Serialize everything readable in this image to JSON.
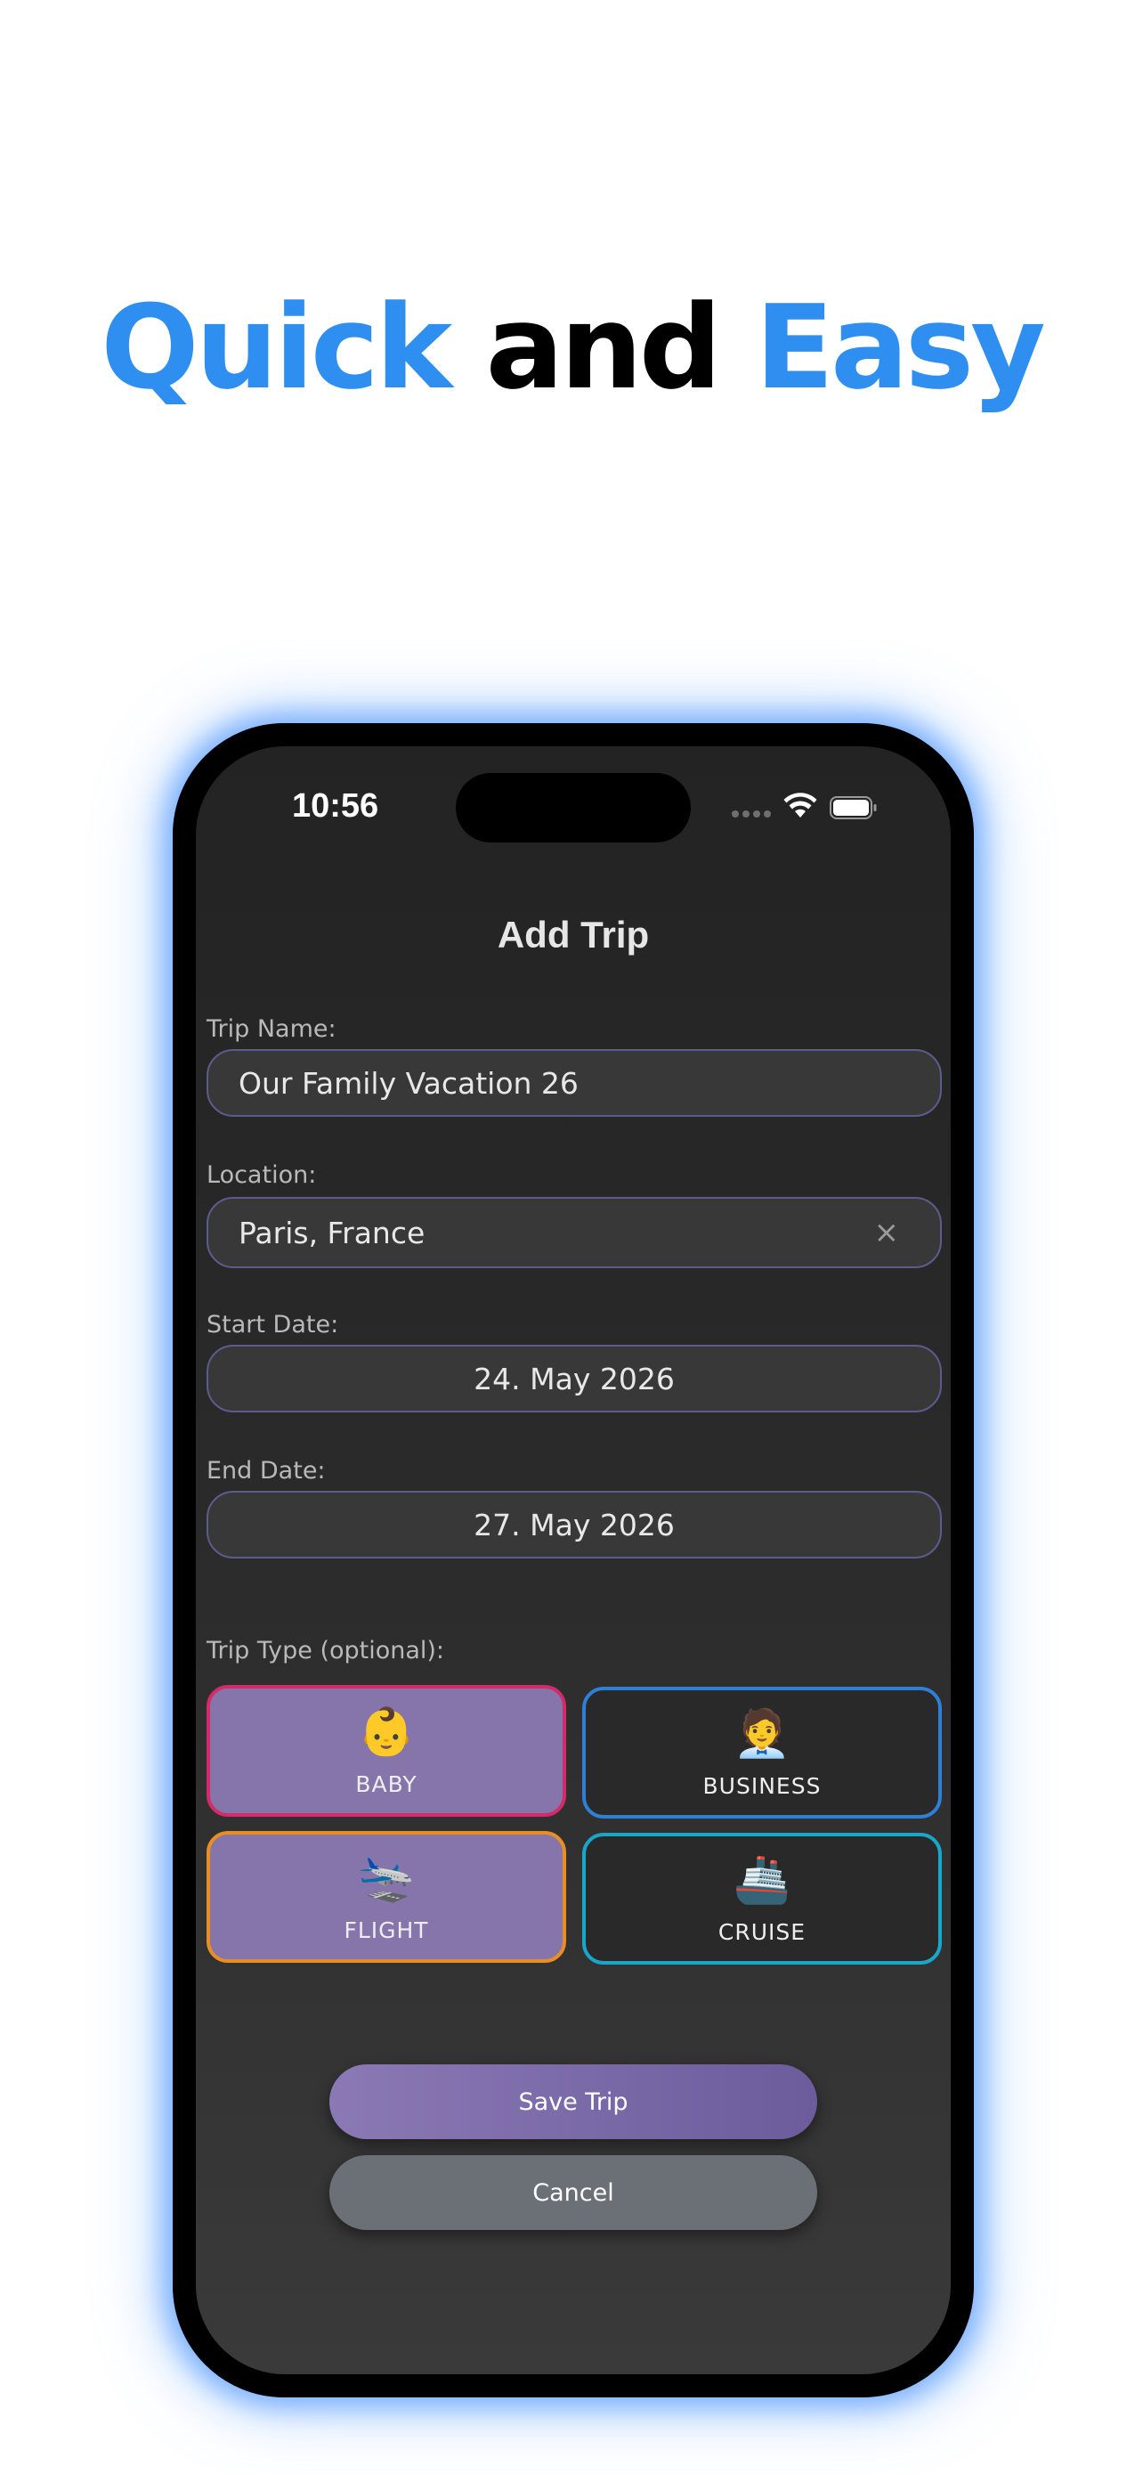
{
  "headline": {
    "word1": "Quick",
    "word2": "and",
    "word3": "Easy"
  },
  "status_bar": {
    "time": "10:56"
  },
  "screen": {
    "title": "Add Trip"
  },
  "form": {
    "trip_name_label": "Trip Name:",
    "trip_name_value": "Our Family Vacation 26",
    "location_label": "Location:",
    "location_value": "Paris, France",
    "clear_glyph": "×",
    "start_date_label": "Start Date:",
    "start_date_value": "24. May 2026",
    "end_date_label": "End Date:",
    "end_date_value": "27. May 2026",
    "trip_type_label": "Trip Type (optional):"
  },
  "trip_types": [
    {
      "label": "BABY",
      "emoji": "👶",
      "selected": true,
      "border_color": "#d52a6a"
    },
    {
      "label": "BUSINESS",
      "emoji": "🧑‍💼",
      "selected": false,
      "border_color": "#2f7fd6"
    },
    {
      "label": "FLIGHT",
      "emoji": "🛬",
      "selected": true,
      "border_color": "#e88e23"
    },
    {
      "label": "CRUISE",
      "emoji": "🚢",
      "selected": false,
      "border_color": "#18a7c9"
    }
  ],
  "buttons": {
    "save": "Save Trip",
    "cancel": "Cancel"
  },
  "colors": {
    "accent_blue": "#2f8ff0",
    "selected_card": "#8675ab",
    "field_border": "#5f5a8e"
  },
  "icons": {
    "wifi": "wifi-icon",
    "battery": "battery-icon",
    "signal": "cellular-signal-icon",
    "clear": "close-icon"
  }
}
